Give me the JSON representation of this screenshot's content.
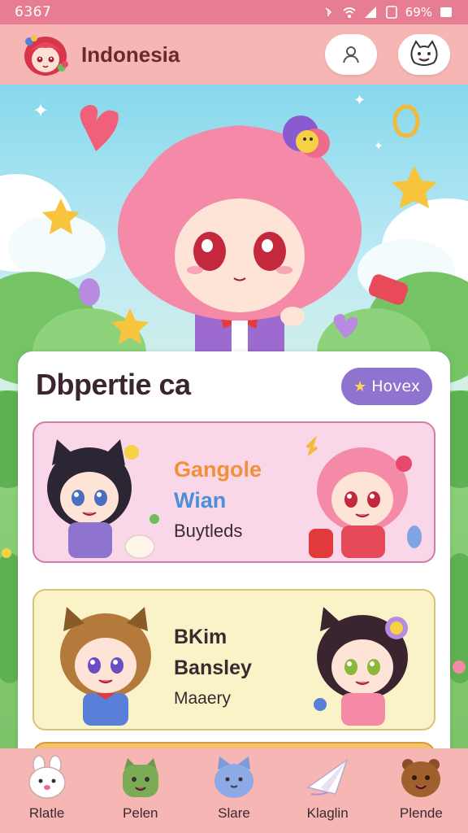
{
  "status_bar": {
    "time": "6367",
    "battery": "69%",
    "icons": [
      "bluetooth-icon",
      "wifi-icon",
      "signal-icon",
      "sim-icon",
      "battery-icon"
    ]
  },
  "header": {
    "title": "Indonesia",
    "logo_icon": "anime-girl-avatar-icon",
    "buttons": [
      "profile-icon",
      "cat-face-icon"
    ]
  },
  "hero": {
    "illustration": "pink-haired-chibi-girl"
  },
  "card": {
    "title": "Dbpertie ca",
    "action_button": {
      "label": "Hovex",
      "icon": "star-icon"
    },
    "entries": [
      {
        "line1": "Gangole",
        "line2": "Wian",
        "line3": "Buytleds",
        "bg": "#f9d7e8"
      },
      {
        "line1": "BKim",
        "line2": "Bansley",
        "line3": "Maaery",
        "bg": "#fbf3c8"
      }
    ]
  },
  "bottom_nav": {
    "items": [
      {
        "label": "Rlatle",
        "icon": "bunny-icon"
      },
      {
        "label": "Pelen",
        "icon": "green-cat-icon"
      },
      {
        "label": "Slare",
        "icon": "blue-cat-icon"
      },
      {
        "label": "Klaglin",
        "icon": "paper-plane-icon"
      },
      {
        "label": "Plende",
        "icon": "brown-bear-icon"
      }
    ]
  },
  "colors": {
    "status_bar": "#e67d92",
    "header": "#f6b6b4",
    "accent_button": "#8e73cf"
  }
}
